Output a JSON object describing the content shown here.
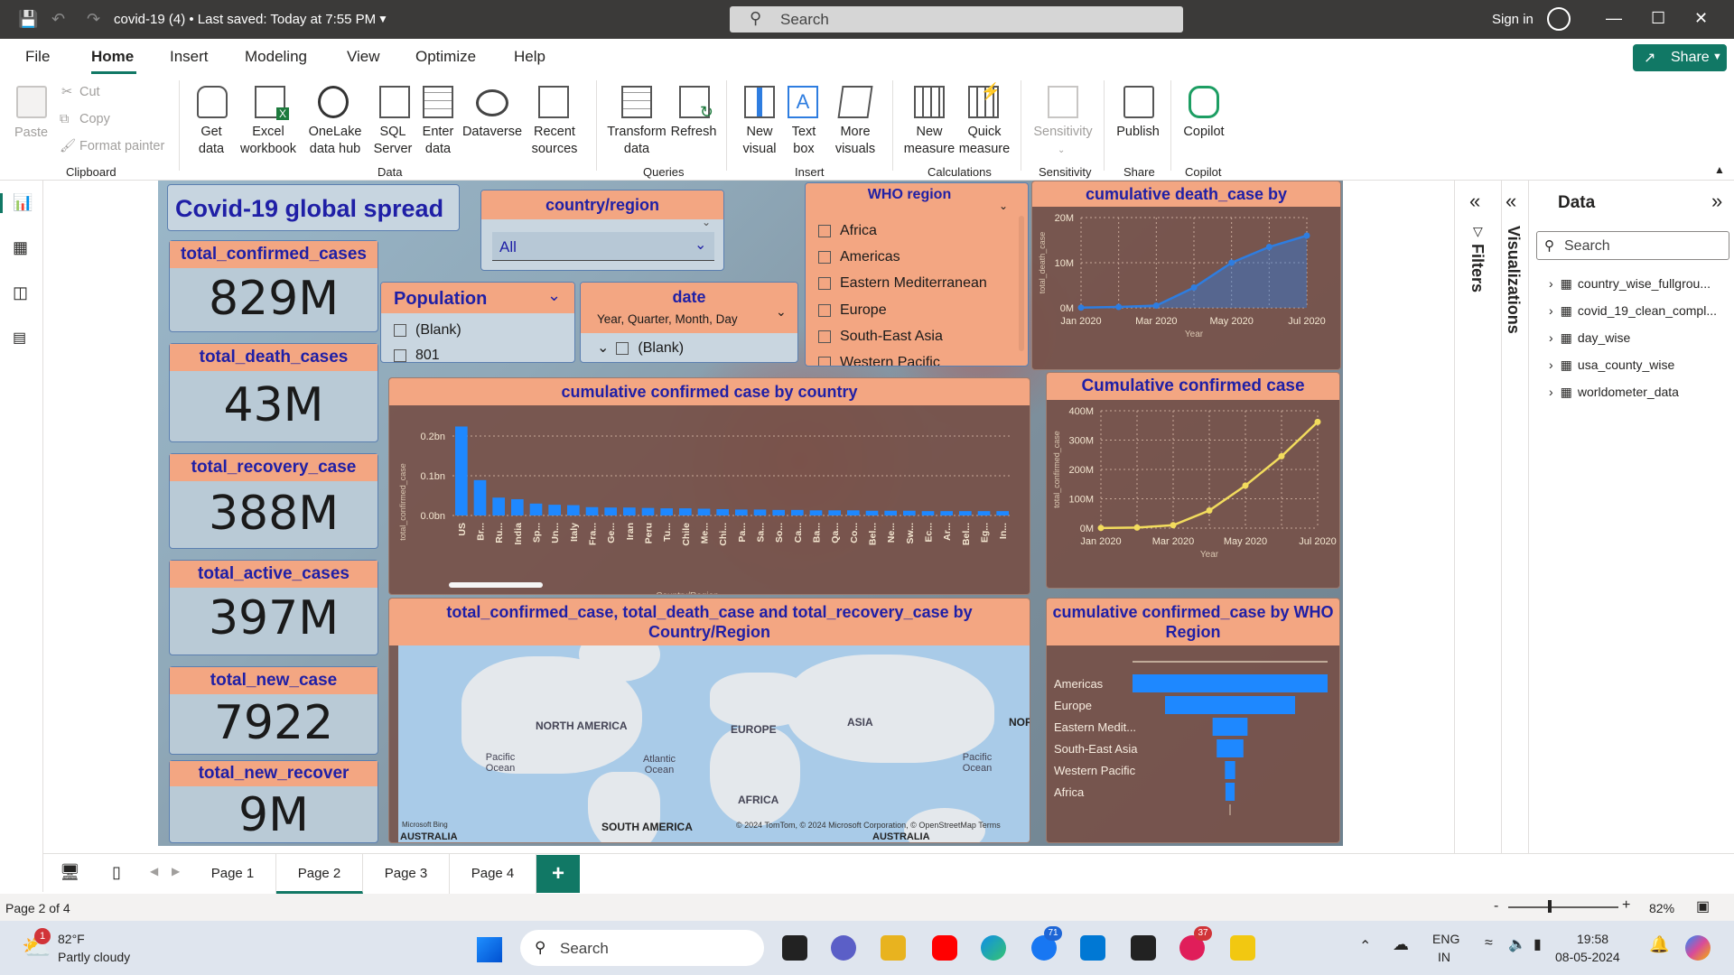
{
  "titlebar": {
    "doc_title": "covid-19 (4)  •  Last saved: Today at 7:55 PM",
    "search_placeholder": "Search",
    "sign_in": "Sign in"
  },
  "menu": [
    "File",
    "Home",
    "Insert",
    "Modeling",
    "View",
    "Optimize",
    "Help"
  ],
  "share_label": "Share",
  "ribbon": {
    "clipboard": {
      "paste": "Paste",
      "cut": "Cut",
      "copy": "Copy",
      "format_painter": "Format painter",
      "group": "Clipboard"
    },
    "data": {
      "get_data": "Get data",
      "excel": "Excel workbook",
      "onelake": "OneLake data hub",
      "sql": "SQL Server",
      "enter": "Enter data",
      "dataverse": "Dataverse",
      "recent": "Recent sources",
      "group": "Data"
    },
    "queries": {
      "transform": "Transform data",
      "refresh": "Refresh",
      "group": "Queries"
    },
    "insert": {
      "new_visual": "New visual",
      "text_box": "Text box",
      "more_visuals": "More visuals",
      "group": "Insert"
    },
    "calculations": {
      "new_measure": "New measure",
      "quick_measure": "Quick measure",
      "group": "Calculations"
    },
    "sensitivity": {
      "label": "Sensitivity",
      "group": "Sensitivity"
    },
    "share": {
      "publish": "Publish",
      "group": "Share"
    },
    "copilot": {
      "label": "Copilot",
      "group": "Copilot"
    }
  },
  "report": {
    "title": "Covid-19 global spread",
    "cards": [
      {
        "label": "total_confirmed_cases",
        "value": "829M"
      },
      {
        "label": "total_death_cases",
        "value": "43M"
      },
      {
        "label": "total_recovery_case",
        "value": "388M"
      },
      {
        "label": "total_active_cases",
        "value": "397M"
      },
      {
        "label": "total_new_case",
        "value": "7922"
      },
      {
        "label": "total_new_recover",
        "value": "9M"
      }
    ],
    "country_slicer": {
      "title": "country/region",
      "value": "All"
    },
    "population_slicer": {
      "title": "Population",
      "options": [
        "(Blank)",
        "801"
      ]
    },
    "date_slicer": {
      "title": "date",
      "hierarchy": "Year, Quarter, Month, Day",
      "options": [
        "(Blank)"
      ]
    },
    "who_slicer": {
      "title": "WHO region",
      "options": [
        "Africa",
        "Americas",
        "Eastern Mediterranean",
        "Europe",
        "South-East Asia",
        "Western Pacific"
      ]
    },
    "map": {
      "title": "total_confirmed_case, total_death_case and total_recovery_case by Country/Region",
      "labels": [
        "NORTH AMERICA",
        "EUROPE",
        "ASIA",
        "AFRICA",
        "SOUTH AMERICA",
        "AUSTRALIA",
        "AUSTRALIA",
        "NOR"
      ],
      "oceans": [
        "Pacific Ocean",
        "Atlantic Ocean",
        "Pacific Ocean"
      ],
      "credit": "© 2024 TomTom, © 2024 Microsoft Corporation, © OpenStreetMap  Terms",
      "bing": "Microsoft Bing"
    }
  },
  "chart_data": [
    {
      "type": "line",
      "title": "cumulative death_case by",
      "xlabel": "Year",
      "ylabel": "total_death_case",
      "x": [
        "Jan 2020",
        "Feb 2020",
        "Mar 2020",
        "Apr 2020",
        "May 2020",
        "Jun 2020",
        "Jul 2020"
      ],
      "values": [
        0.05,
        0.2,
        0.5,
        4.5,
        10,
        13.5,
        16
      ],
      "yticks": [
        "0M",
        "10M",
        "20M"
      ],
      "xticks": [
        "Jan 2020",
        "Mar 2020",
        "May 2020",
        "Jul 2020"
      ],
      "ylim": [
        0,
        20
      ],
      "fill": true,
      "color": "#2e7de0"
    },
    {
      "type": "bar",
      "title": "cumulative confirmed case by country",
      "xlabel": "Country/Region",
      "ylabel": "total_confirmed_case",
      "categories": [
        "US",
        "Br...",
        "Ru...",
        "India",
        "Sp...",
        "Un...",
        "Italy",
        "Fra...",
        "Ge...",
        "Iran",
        "Peru",
        "Tu...",
        "Chile",
        "Me...",
        "Chi...",
        "Pa...",
        "Sa...",
        "So...",
        "Ca...",
        "Ba...",
        "Qa...",
        "Co...",
        "Bel...",
        "Ne...",
        "Sw...",
        "Ec...",
        "Ar...",
        "Bel...",
        "Eg...",
        "In..."
      ],
      "values": [
        0.224,
        0.089,
        0.045,
        0.041,
        0.03,
        0.027,
        0.026,
        0.021,
        0.02,
        0.02,
        0.019,
        0.018,
        0.018,
        0.017,
        0.016,
        0.015,
        0.015,
        0.014,
        0.014,
        0.013,
        0.013,
        0.013,
        0.012,
        0.012,
        0.012,
        0.011,
        0.011,
        0.011,
        0.011,
        0.011
      ],
      "yticks": [
        "0.0bn",
        "0.1bn",
        "0.2bn"
      ],
      "ylim": [
        0,
        0.25
      ],
      "color": "#1e88ff"
    },
    {
      "type": "line",
      "title": "Cumulative confirmed case",
      "xlabel": "Year",
      "ylabel": "total_confirmed_case",
      "x": [
        "Jan 2020",
        "Feb 2020",
        "Mar 2020",
        "Apr 2020",
        "May 2020",
        "Jun 2020",
        "Jul 2020"
      ],
      "values": [
        0.5,
        2,
        10,
        60,
        145,
        245,
        362
      ],
      "yticks": [
        "0M",
        "100M",
        "200M",
        "300M",
        "400M"
      ],
      "xticks": [
        "Jan 2020",
        "Mar 2020",
        "May 2020",
        "Jul 2020"
      ],
      "ylim": [
        0,
        400
      ],
      "color": "#f2dc5d"
    },
    {
      "type": "bar",
      "orientation": "funnel",
      "title": "cumulative confirmed_case by WHO Region",
      "categories": [
        "Americas",
        "Europe",
        "Eastern Medit...",
        "South-East Asia",
        "Western Pacific",
        "Africa"
      ],
      "values": [
        402,
        268,
        72,
        55,
        21,
        19
      ],
      "color": "#1e88ff"
    }
  ],
  "filters_label": "Filters",
  "viz_label": "Visualizations",
  "data_pane": {
    "title": "Data",
    "search": "Search",
    "tables": [
      "country_wise_fullgrou...",
      "covid_19_clean_compl...",
      "day_wise",
      "usa_county_wise",
      "worldometer_data"
    ]
  },
  "pages": [
    "Page 1",
    "Page 2",
    "Page 3",
    "Page 4"
  ],
  "status": {
    "page": "Page 2 of 4",
    "zoom": "82%"
  },
  "taskbar": {
    "weather_temp": "82°F",
    "weather_desc": "Partly cloudy",
    "search": "Search",
    "lang1": "ENG",
    "lang2": "IN",
    "time": "19:58",
    "date": "08-05-2024",
    "badge1": "71",
    "badge2": "37",
    "weather_badge": "1"
  }
}
